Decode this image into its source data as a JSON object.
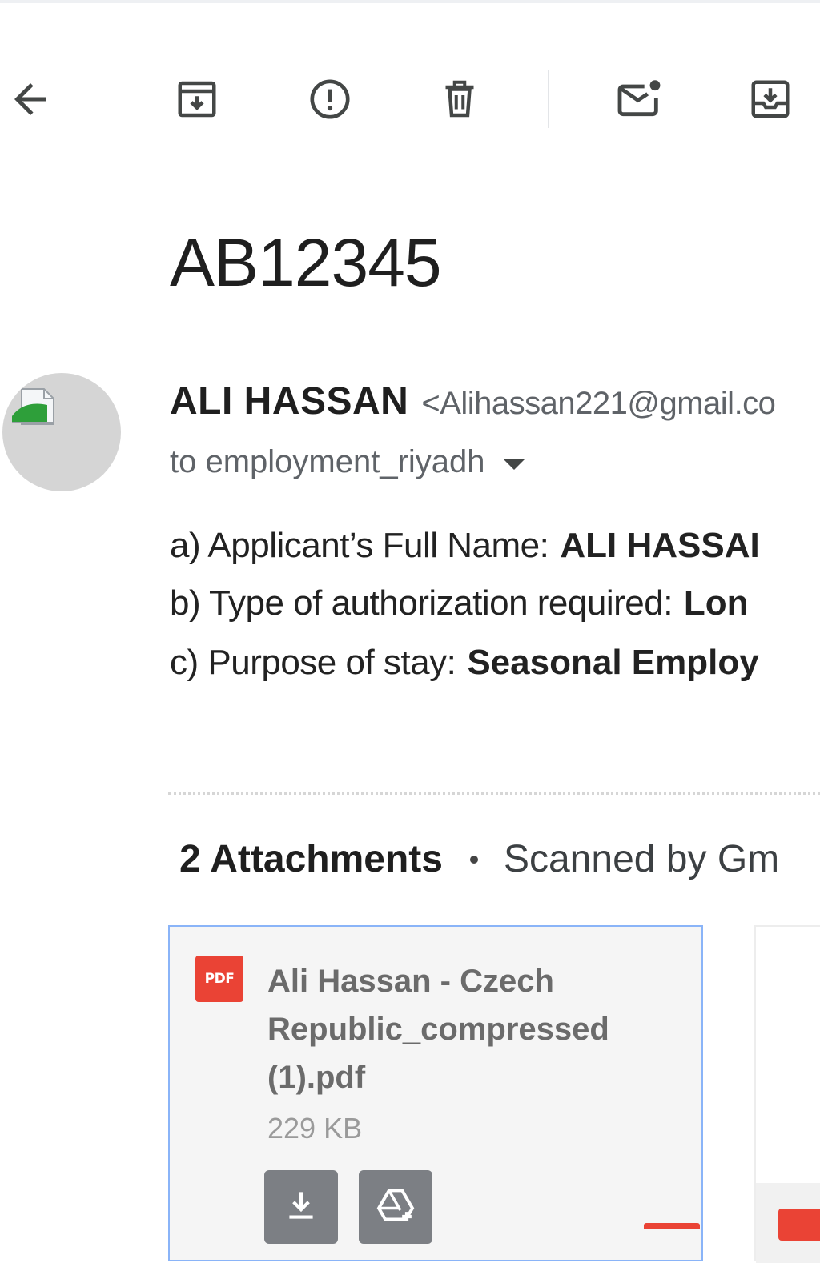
{
  "toolbar": {
    "icons": [
      "back-arrow-icon",
      "archive-icon",
      "report-spam-icon",
      "delete-icon",
      "mark-unread-icon",
      "move-to-inbox-icon"
    ]
  },
  "email": {
    "subject": "AB12345",
    "sender": {
      "name": "ALI HASSAN",
      "email_partial": "<Alihassan221@gmail.co"
    },
    "recipient": "to employment_riyadh",
    "body": [
      {
        "label": "a) Applicant’s Full Name:",
        "value": "ALI HASSAI"
      },
      {
        "label": "b) Type of authorization required:",
        "value": "Lon"
      },
      {
        "label": "c) Purpose of stay:",
        "value": "Seasonal Employ"
      }
    ]
  },
  "attachments": {
    "count_label": "2 Attachments",
    "scan_label": "Scanned by Gm",
    "items": [
      {
        "icon_text": "PDF",
        "file_name": "Ali Hassan - Czech Republic_compressed (1).pdf",
        "size": "229 KB"
      }
    ]
  },
  "colors": {
    "pdf_red": "#ea4335",
    "card_border_selected": "#8ab4f8",
    "avatar_gray": "#d5d5d5",
    "text_primary": "#1f1f1f",
    "text_secondary": "#5f6368"
  }
}
